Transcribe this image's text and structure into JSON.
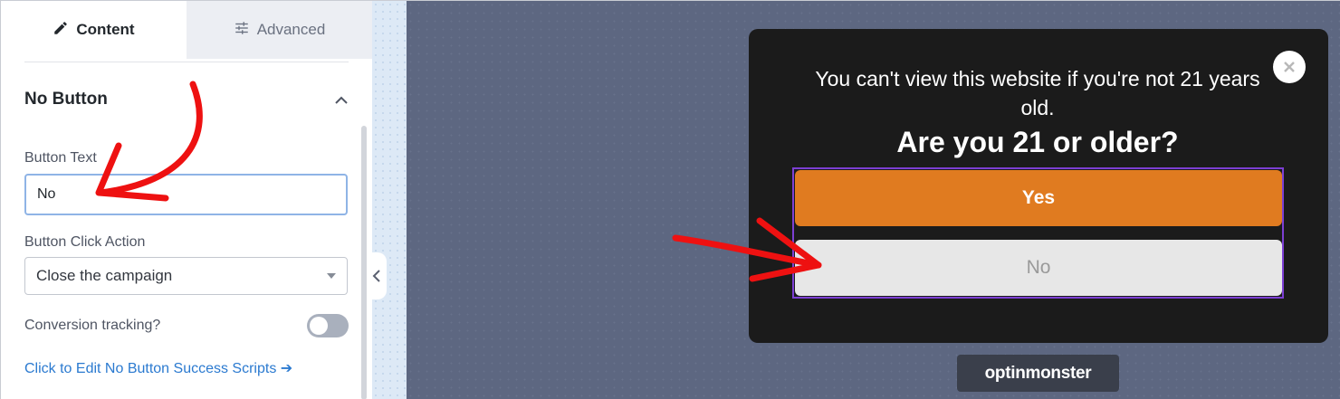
{
  "tabs": [
    {
      "label": "Content",
      "icon": "pencil-icon",
      "active": true
    },
    {
      "label": "Advanced",
      "icon": "sliders-icon",
      "active": false
    }
  ],
  "section": {
    "title": "No Button",
    "icon": "chevron-up-icon"
  },
  "fields": {
    "button_text_label": "Button Text",
    "button_text_value": "No",
    "click_action_label": "Button Click Action",
    "click_action_value": "Close the campaign",
    "conversion_label": "Conversion tracking?",
    "conversion_enabled": false,
    "scripts_link": "Click to Edit No Button Success Scripts ➔"
  },
  "popup": {
    "subtext": "You can't view this website if you're not 21 years old.",
    "headline": "Are you 21 or older?",
    "yes_label": "Yes",
    "no_label": "No",
    "close_icon": "close-icon"
  },
  "branding": {
    "logo_text": "optinmonster"
  },
  "colors": {
    "canvas": "#5d6781",
    "popup_bg": "#1b1b1b",
    "yes_button": "#e07b20",
    "no_button": "#e7e7e7",
    "selection": "#7c3fd3",
    "annotation_arrow": "#ee1111",
    "link": "#2b7ad0"
  }
}
